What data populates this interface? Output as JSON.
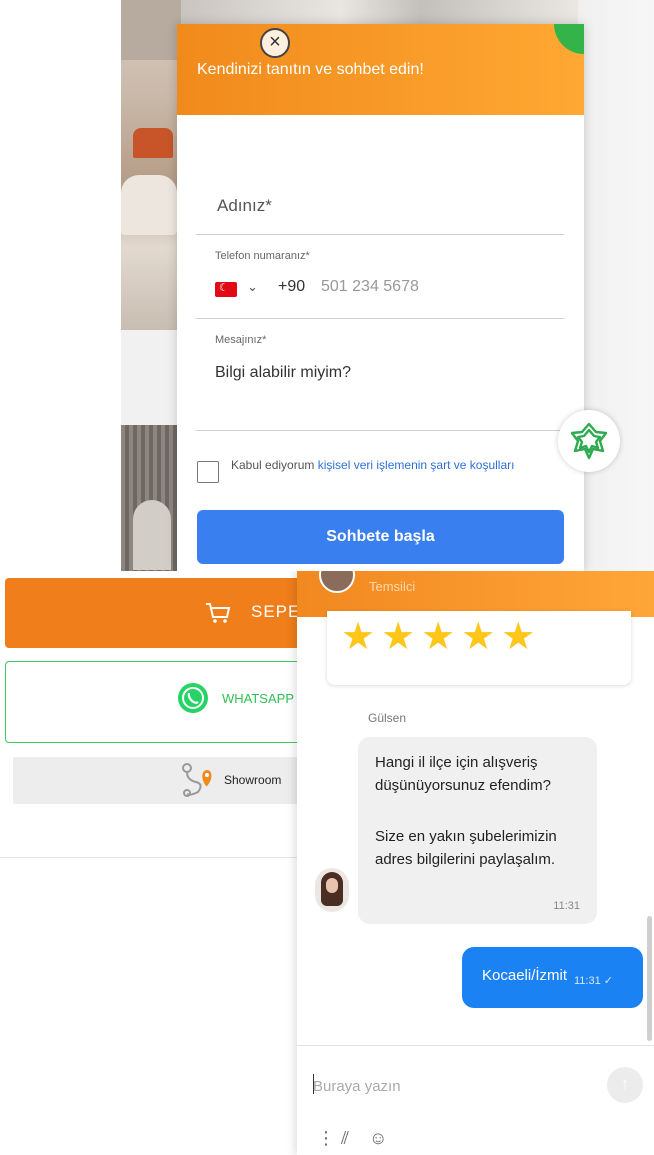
{
  "form": {
    "header_title": "Kendinizi tanıtın ve sohbet edin!",
    "close_glyph": "×",
    "name_placeholder": "Adınız*",
    "phone_label": "Telefon numaranız*",
    "phone_prefix": "+90",
    "phone_placeholder": "501 234 5678",
    "message_label": "Mesajınız*",
    "message_value": "Bilgi alabilir miyim?",
    "consent_prefix": "Kabul ediyorum ",
    "consent_link": "kişisel veri işlemenin şart ve koşulları",
    "start_button": "Sohbete başla",
    "chevron": "⌄"
  },
  "page": {
    "cart_button": "SEPE",
    "whatsapp_button": "WHATSAPP",
    "showroom_button": "Showroom"
  },
  "chat": {
    "agent_role": "Temsilci",
    "stars": "★★★★★",
    "sender_name": "Gülsen",
    "incoming_message_1": "Hangi il ilçe için alışveriş düşünüyorsunuz efendim?",
    "incoming_message_2": "Size en yakın şubelerimizin adres bilgilerini paylaşalım.",
    "incoming_time": "11:31",
    "outgoing_message": "Kocaeli/İzmit",
    "outgoing_time": "11:31 ✓",
    "input_placeholder": "Buraya yazın",
    "send_glyph": "↑",
    "tool_more": "⋮",
    "tool_attach": "⫽",
    "tool_emoji": "☺"
  },
  "colors": {
    "header_orange": "#f08a1c",
    "primary_blue": "#3a7ff0",
    "outgoing_blue": "#1b82f3",
    "whatsapp_green": "#25d366",
    "star_yellow": "#ffc61a"
  }
}
